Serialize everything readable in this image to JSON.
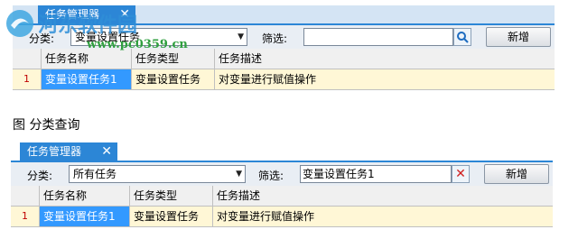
{
  "top": {
    "tab_label": "任务管理器",
    "close_glyph": "✕",
    "category_label": "分类:",
    "category_value": "变量设置任务",
    "filter_label": "筛选:",
    "search_value": "",
    "add_button": "新增",
    "columns": [
      "任务名称",
      "任务类型",
      "任务描述"
    ],
    "rows": [
      {
        "num": "1",
        "name": "变量设置任务1",
        "type": "变量设置任务",
        "desc": "对变量进行赋值操作"
      }
    ]
  },
  "caption": "图 分类查询",
  "bottom": {
    "tab_label": "任务管理器",
    "close_glyph": "✕",
    "category_label": "分类:",
    "category_value": "所有任务",
    "filter_label": "筛选:",
    "search_value": "变量设置任务1",
    "add_button": "新增",
    "columns": [
      "任务名称",
      "任务类型",
      "任务描述"
    ],
    "rows": [
      {
        "num": "1",
        "name": "变量设置任务1",
        "type": "变量设置任务",
        "desc": "对变量进行赋值操作"
      }
    ]
  },
  "watermark": {
    "title": "河东软件园",
    "url": "www.pc0359.cn"
  },
  "colors": {
    "tab_blue": "#2c86d6",
    "row_yellow": "#fff7d6",
    "selection_blue": "#3399ff",
    "clear_red": "#d02020"
  }
}
